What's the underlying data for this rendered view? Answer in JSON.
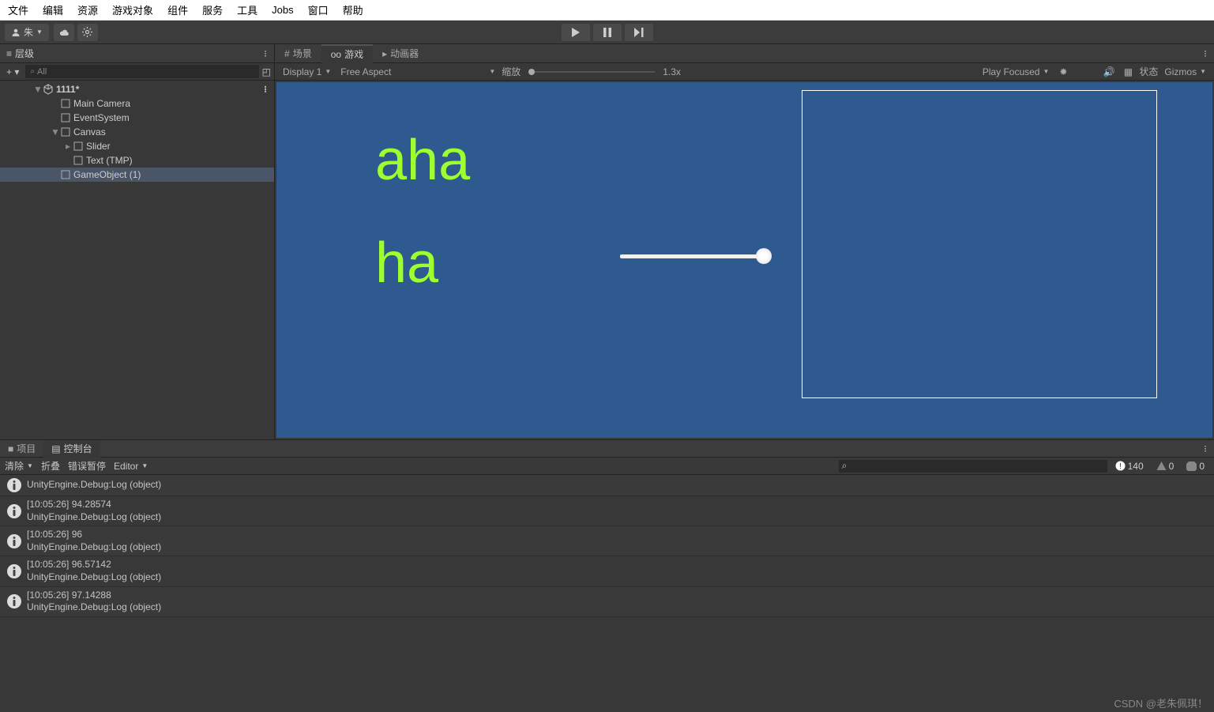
{
  "menubar": [
    "文件",
    "编辑",
    "资源",
    "游戏对象",
    "组件",
    "服务",
    "工具",
    "Jobs",
    "窗口",
    "帮助"
  ],
  "toolbar": {
    "user": "朱"
  },
  "hierarchy": {
    "title": "层级",
    "search_placeholder": "All",
    "scene": "1111*",
    "items": [
      "Main Camera",
      "EventSystem",
      "Canvas",
      "Slider",
      "Text (TMP)",
      "GameObject (1)"
    ]
  },
  "game": {
    "tabs": {
      "scene": "场景",
      "game": "游戏",
      "animator": "动画器"
    },
    "display": "Display 1",
    "aspect": "Free Aspect",
    "zoom_label": "缩放",
    "zoom_value": "1.3x",
    "play_focused": "Play Focused",
    "status": "状态",
    "gizmos": "Gizmos",
    "text_line1": "aha",
    "text_line2": "ha"
  },
  "console": {
    "tabs": {
      "project": "项目",
      "console": "控制台"
    },
    "clear": "清除",
    "collapse": "折叠",
    "error_pause": "错误暂停",
    "editor": "Editor",
    "info_count": "140",
    "warn_count": "0",
    "err_count": "0",
    "logs": [
      {
        "msg": "UnityEngine.Debug:Log (object)"
      },
      {
        "ts": "[10:05:26] 94.28574",
        "msg": "UnityEngine.Debug:Log (object)"
      },
      {
        "ts": "[10:05:26] 96",
        "msg": "UnityEngine.Debug:Log (object)"
      },
      {
        "ts": "[10:05:26] 96.57142",
        "msg": "UnityEngine.Debug:Log (object)"
      },
      {
        "ts": "[10:05:26] 97.14288",
        "msg": "UnityEngine.Debug:Log (object)"
      }
    ]
  },
  "watermark": "CSDN @老朱佩琪！"
}
